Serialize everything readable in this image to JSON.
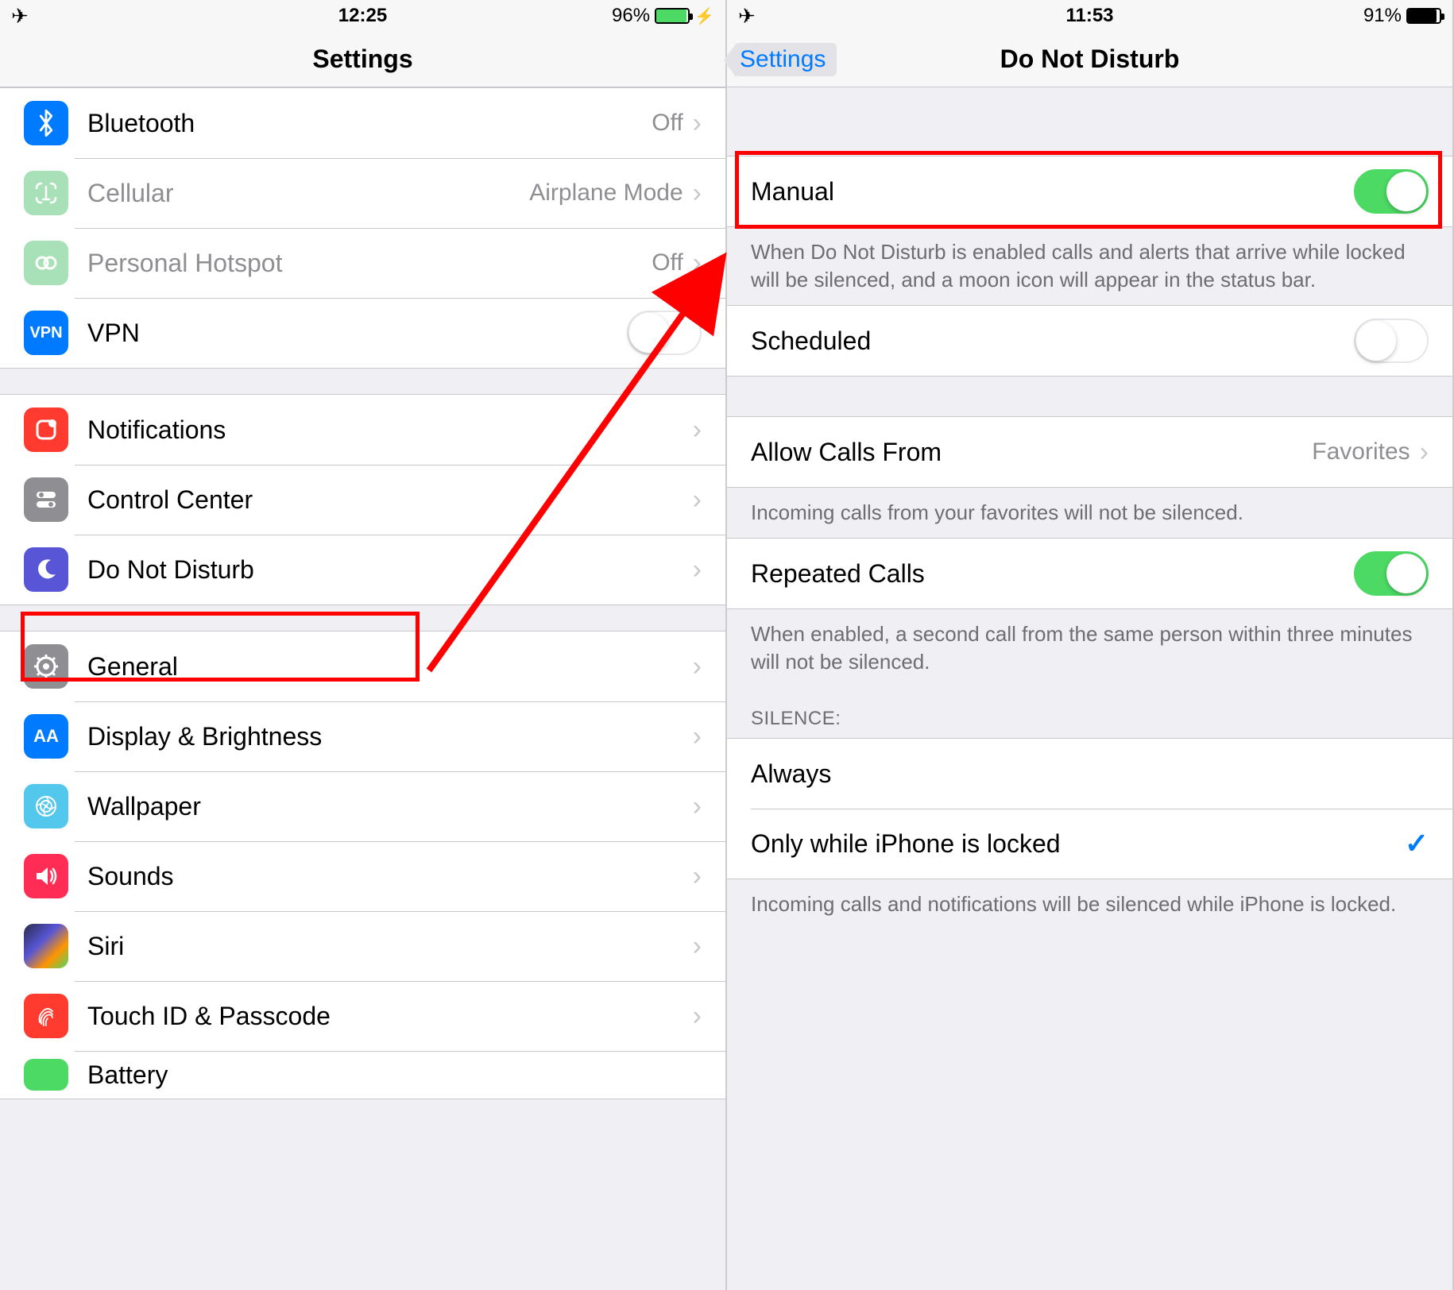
{
  "left": {
    "status": {
      "time": "12:25",
      "battery_pct": "96%",
      "charging": true
    },
    "title": "Settings",
    "rows": {
      "bluetooth": {
        "label": "Bluetooth",
        "value": "Off"
      },
      "cellular": {
        "label": "Cellular",
        "value": "Airplane Mode"
      },
      "hotspot": {
        "label": "Personal Hotspot",
        "value": "Off"
      },
      "vpn": {
        "label": "VPN",
        "icon_text": "VPN"
      },
      "notifications": {
        "label": "Notifications"
      },
      "control_center": {
        "label": "Control Center"
      },
      "dnd": {
        "label": "Do Not Disturb"
      },
      "general": {
        "label": "General"
      },
      "display": {
        "label": "Display & Brightness",
        "icon_text": "AA"
      },
      "wallpaper": {
        "label": "Wallpaper"
      },
      "sounds": {
        "label": "Sounds"
      },
      "siri": {
        "label": "Siri"
      },
      "touchid": {
        "label": "Touch ID & Passcode"
      },
      "battery": {
        "label": "Battery"
      }
    }
  },
  "right": {
    "status": {
      "time": "11:53",
      "battery_pct": "91%"
    },
    "back": "Settings",
    "title": "Do Not Disturb",
    "manual": {
      "label": "Manual"
    },
    "manual_footer": "When Do Not Disturb is enabled calls and alerts that arrive while locked will be silenced, and a moon icon will appear in the status bar.",
    "scheduled": {
      "label": "Scheduled"
    },
    "allow_from": {
      "label": "Allow Calls From",
      "value": "Favorites"
    },
    "allow_footer": "Incoming calls from your favorites will not be silenced.",
    "repeated": {
      "label": "Repeated Calls"
    },
    "repeated_footer": "When enabled, a second call from the same person within three minutes will not be silenced.",
    "silence_header": "SILENCE:",
    "always": {
      "label": "Always"
    },
    "only_locked": {
      "label": "Only while iPhone is locked"
    },
    "silence_footer": "Incoming calls and notifications will be silenced while iPhone is locked."
  }
}
